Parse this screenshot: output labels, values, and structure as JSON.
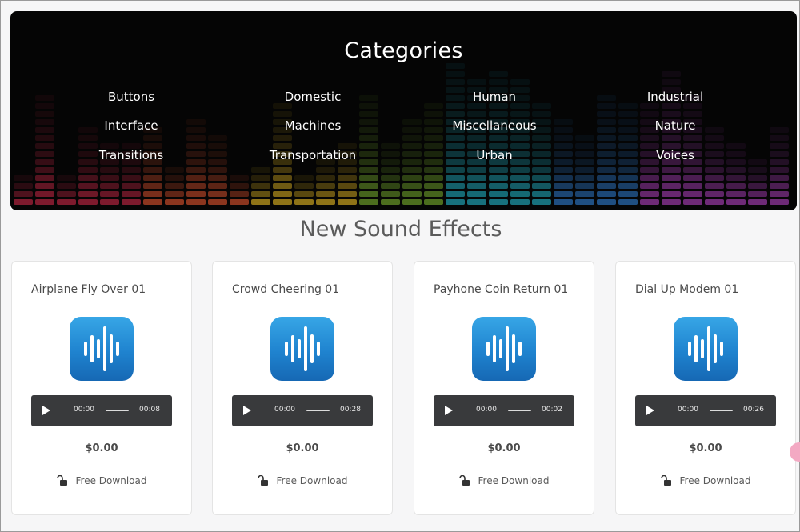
{
  "categories": {
    "title": "Categories",
    "rows": [
      [
        "Buttons",
        "Domestic",
        "Human",
        "Industrial"
      ],
      [
        "Interface",
        "Machines",
        "Miscellaneous",
        "Nature"
      ],
      [
        "Transitions",
        "Transportation",
        "Urban",
        "Voices"
      ]
    ]
  },
  "section_title": "New Sound Effects",
  "cards": [
    {
      "title": "Airplane Fly Over 01",
      "current": "00:00",
      "duration": "00:08",
      "price": "$0.00",
      "download": "Free Download"
    },
    {
      "title": "Crowd Cheering 01",
      "current": "00:00",
      "duration": "00:28",
      "price": "$0.00",
      "download": "Free Download"
    },
    {
      "title": "Payhone Coin Return 01",
      "current": "00:00",
      "duration": "00:02",
      "price": "$0.00",
      "download": "Free Download"
    },
    {
      "title": "Dial Up Modem 01",
      "current": "00:00",
      "duration": "00:26",
      "price": "$0.00",
      "download": "Free Download"
    }
  ],
  "icons": {
    "card_icon": "sound-wave-icon",
    "play": "play-icon",
    "download": "unlock-icon"
  },
  "colors": {
    "banner_bg": "#050505",
    "player_bg": "#393a3c",
    "icon_blue": "#1f83cf",
    "page_bg": "#f6f6f7"
  }
}
